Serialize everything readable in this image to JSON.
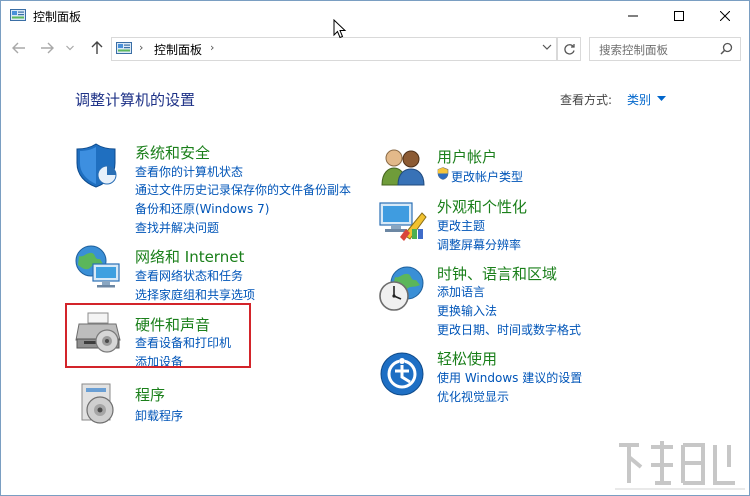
{
  "window": {
    "title": "控制面板"
  },
  "address": {
    "crumb": "控制面板",
    "sep1": "›",
    "sep2": "›"
  },
  "search": {
    "placeholder": "搜索控制面板"
  },
  "header": {
    "heading": "调整计算机的设置",
    "view_by_label": "查看方式:",
    "view_by_value": "类别"
  },
  "left": [
    {
      "title": "系统和安全",
      "icon": "shield-icon",
      "links": [
        "查看你的计算机状态",
        "通过文件历史记录保存你的文件备份副本",
        "备份和还原(Windows 7)",
        "查找并解决问题"
      ]
    },
    {
      "title": "网络和 Internet",
      "icon": "network-icon",
      "links": [
        "查看网络状态和任务",
        "选择家庭组和共享选项"
      ]
    },
    {
      "title": "硬件和声音",
      "icon": "printer-icon",
      "links": [
        "查看设备和打印机",
        "添加设备"
      ]
    },
    {
      "title": "程序",
      "icon": "programs-icon",
      "links": [
        "卸载程序"
      ]
    }
  ],
  "right": [
    {
      "title": "用户帐户",
      "icon": "users-icon",
      "links": [
        "更改帐户类型"
      ]
    },
    {
      "title": "外观和个性化",
      "icon": "appearance-icon",
      "links": [
        "更改主题",
        "调整屏幕分辨率"
      ]
    },
    {
      "title": "时钟、语言和区域",
      "icon": "clock-globe-icon",
      "links": [
        "添加语言",
        "更换输入法",
        "更改日期、时间或数字格式"
      ]
    },
    {
      "title": "轻松使用",
      "icon": "ease-of-access-icon",
      "links": [
        "使用 Windows 建议的设置",
        "优化视觉显示"
      ]
    }
  ],
  "colors": {
    "heading": "#1e3287",
    "category_title": "#1a7f1a",
    "link": "#0055b8",
    "highlight": "#d3242a"
  }
}
